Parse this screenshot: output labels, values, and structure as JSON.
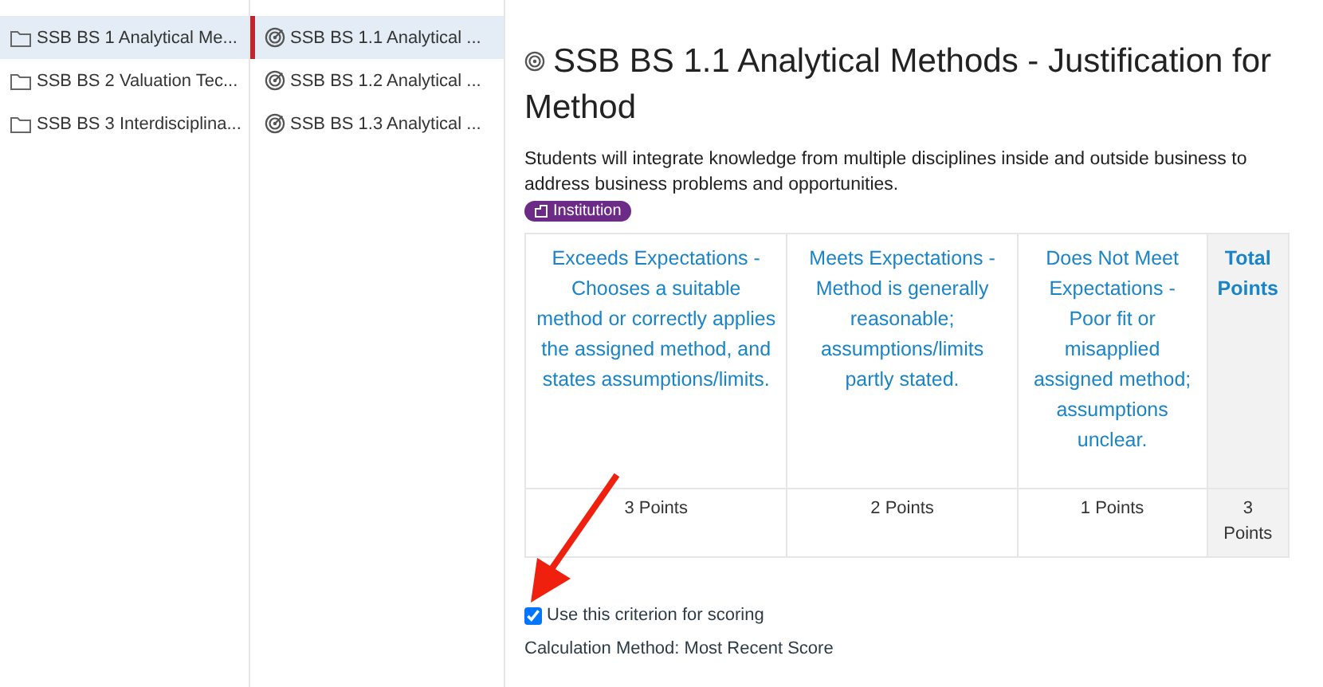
{
  "groups": [
    {
      "label": "SSB BS 1 Analytical Me...",
      "selected": true
    },
    {
      "label": "SSB BS 2 Valuation Tec...",
      "selected": false
    },
    {
      "label": "SSB BS 3 Interdisciplina...",
      "selected": false
    }
  ],
  "outcomes": [
    {
      "label": "SSB BS 1.1 Analytical ...",
      "selected": true
    },
    {
      "label": "SSB BS 1.2 Analytical ...",
      "selected": false
    },
    {
      "label": "SSB BS 1.3 Analytical ...",
      "selected": false
    }
  ],
  "detail": {
    "title": "SSB BS 1.1 Analytical Methods - Justification for Method",
    "description": "Students will integrate knowledge from multiple disciplines inside and outside business to address business problems and opportunities.",
    "badge": "Institution",
    "rubric": {
      "ratings": [
        {
          "description": "Exceeds Expectations - Chooses a suitable method or correctly applies the assigned method, and states assumptions/limits.",
          "points": "3 Points"
        },
        {
          "description": "Meets Expectations - Method is generally reasonable; assumptions/limits partly stated.",
          "points": "2 Points"
        },
        {
          "description": "Does Not Meet Expectations - Poor fit or misapplied assigned method; assumptions unclear.",
          "points": "1 Points"
        }
      ],
      "total_heading": "Total Points",
      "total": "3 Points"
    },
    "use_for_scoring": {
      "label": "Use this criterion for scoring",
      "checked": true
    },
    "calculation": "Calculation Method: Most Recent Score"
  }
}
